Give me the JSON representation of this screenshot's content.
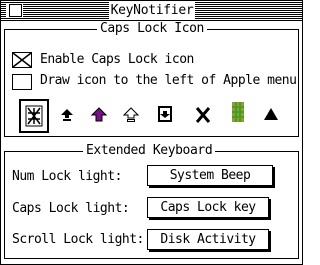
{
  "window": {
    "title": "KeyNotifier"
  },
  "caps_lock_icon": {
    "group_label": "Caps Lock Icon",
    "enable_label": "Enable Caps Lock icon",
    "enable_checked": true,
    "left_of_apple_label": "Draw icon to the left of Apple menu",
    "left_of_apple_checked": false,
    "icons": [
      {
        "name": "keyboard-pattern-icon",
        "selected": true
      },
      {
        "name": "arrow-up-bar-icon",
        "selected": false
      },
      {
        "name": "purple-arrow-up-icon",
        "selected": false
      },
      {
        "name": "outline-arrow-up-icon",
        "selected": false
      },
      {
        "name": "corner-arrow-icon",
        "selected": false
      },
      {
        "name": "x-letter-icon",
        "selected": false
      },
      {
        "name": "green-grid-icon",
        "selected": false
      },
      {
        "name": "triangle-up-icon",
        "selected": false
      }
    ]
  },
  "extended_keyboard": {
    "group_label": "Extended Keyboard",
    "rows": [
      {
        "label": "Num Lock light:",
        "value": "System Beep"
      },
      {
        "label": "Caps Lock light:",
        "value": "Caps Lock key"
      },
      {
        "label": "Scroll Lock light:",
        "value": "Disk Activity"
      }
    ]
  },
  "colors": {
    "purple": "#7a0f8a",
    "green": "#3fa02a",
    "olive": "#9e9a2a"
  }
}
